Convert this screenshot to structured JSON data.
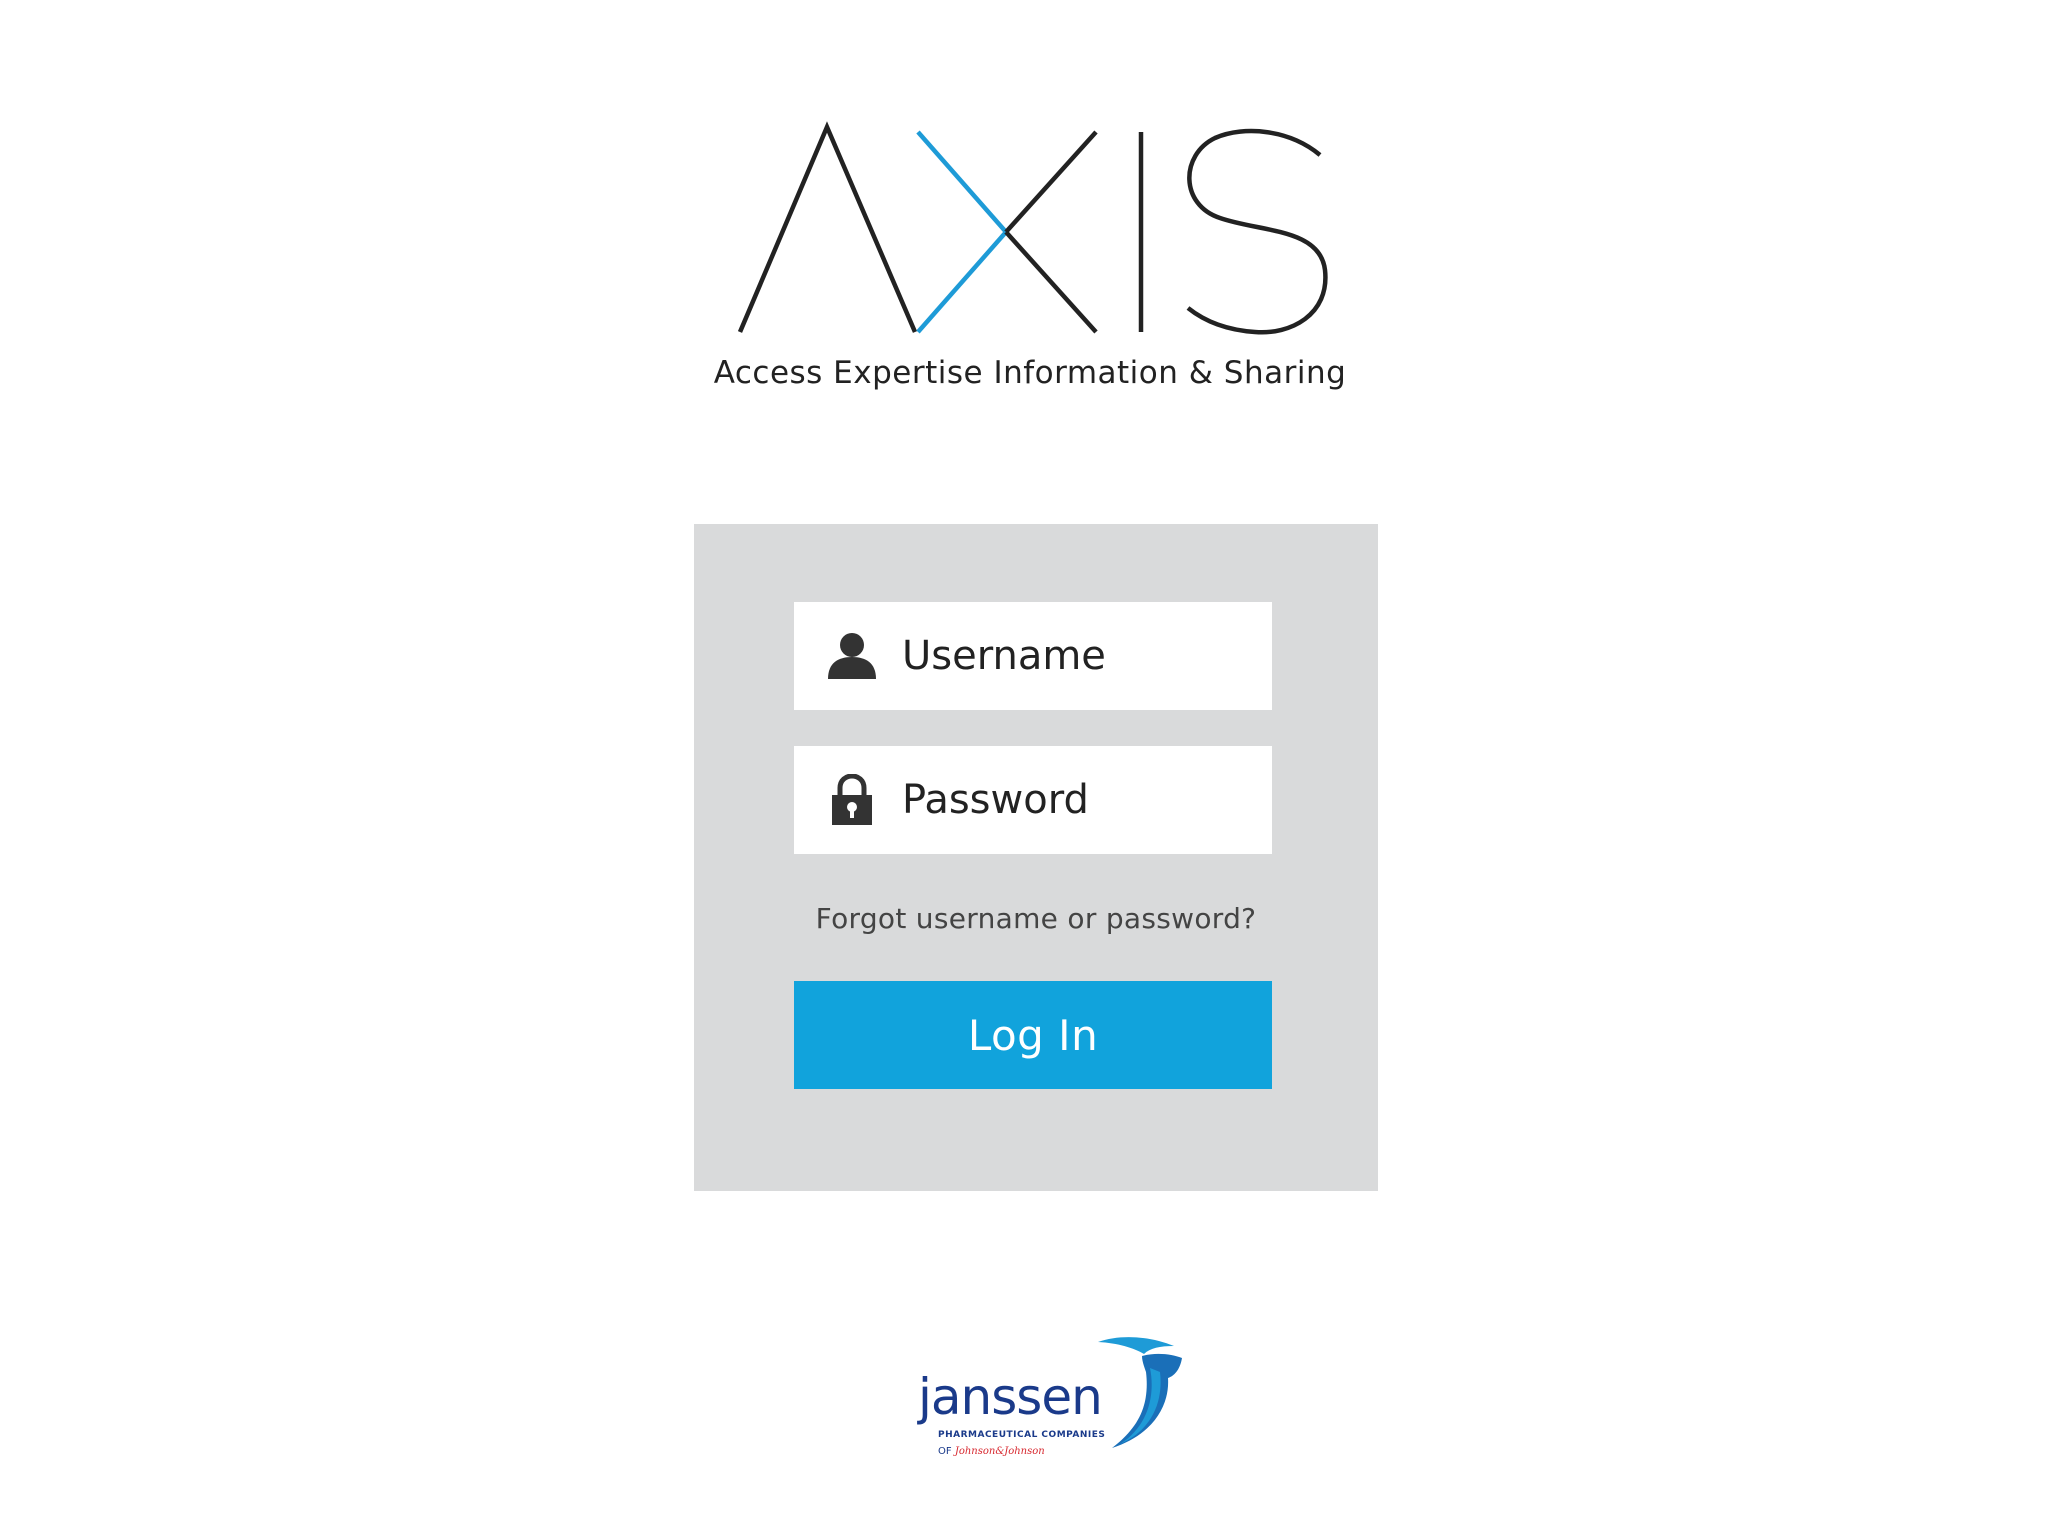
{
  "logo": {
    "wordmark": "AXIS",
    "tagline": "Access Expertise Information & Sharing",
    "colors": {
      "dark": "#222222",
      "accent": "#1e9bd7"
    }
  },
  "login": {
    "username_placeholder": "Username",
    "username_icon": "user-icon",
    "password_placeholder": "Password",
    "password_icon": "lock-icon",
    "forgot_link": "Forgot username or password?",
    "submit_label": "Log In",
    "panel_color": "#d9dadb",
    "button_color": "#11a3dc"
  },
  "brand": {
    "name": "janssen",
    "subtitle": "PHARMACEUTICAL COMPANIES",
    "of": "OF",
    "parent": "Johnson&Johnson",
    "colors": {
      "navy": "#1a3a8a",
      "blue": "#1e9bd7",
      "red": "#d7282f"
    }
  }
}
